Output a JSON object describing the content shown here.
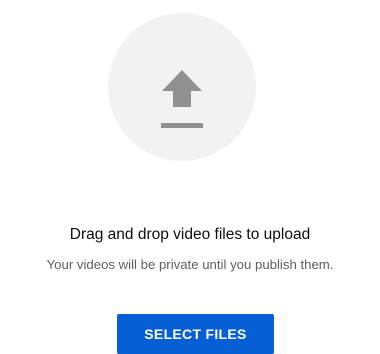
{
  "upload": {
    "icon": "upload-arrow-icon",
    "title": "Drag and drop video files to upload",
    "subtitle": "Your videos will be private until you publish them.",
    "button_label": "SELECT FILES"
  },
  "colors": {
    "button_bg": "#065fd4",
    "circle_bg": "#f2f2f2",
    "icon": "#909090"
  }
}
